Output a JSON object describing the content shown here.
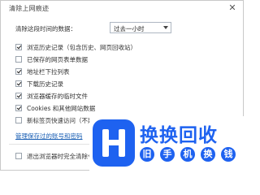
{
  "dialog": {
    "title": "清除上网痕迹",
    "close_glyph": "✕"
  },
  "range": {
    "label": "清除这段时间的数据：",
    "selected": "过去一小时"
  },
  "options": [
    {
      "label": "浏览历史记录（包含历史、网页回收站）",
      "checked": true
    },
    {
      "label": "已保存的网页表单数据",
      "checked": false
    },
    {
      "label": "地址栏下拉列表",
      "checked": true
    },
    {
      "label": "下载历史记录",
      "checked": true
    },
    {
      "label": "浏览器缓存的临时文件",
      "checked": true
    },
    {
      "label": "Cookies 和其他网站数据",
      "checked": true
    },
    {
      "label": "新标签页快速访问（不建",
      "checked": false
    }
  ],
  "link": {
    "label": "管理保存过的账号和密码"
  },
  "footer": {
    "label": "退出浏览器时完全清除今",
    "checked": false
  },
  "watermark": {
    "title": "换换回收",
    "chars": [
      "旧",
      "手",
      "机",
      "换",
      "钱"
    ],
    "brand_color": "#1e62f0"
  }
}
